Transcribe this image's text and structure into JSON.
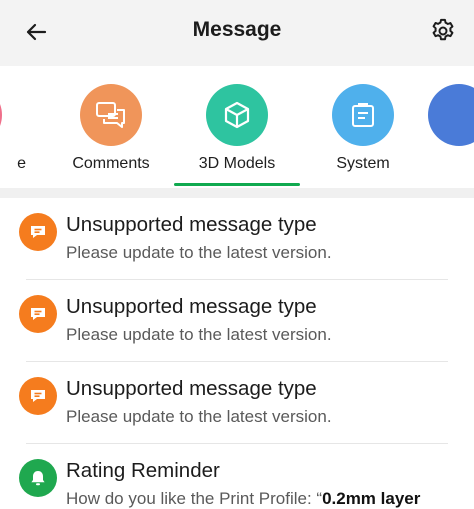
{
  "header": {
    "title": "Message",
    "back_icon": "arrow-left-icon",
    "settings_icon": "gear-icon"
  },
  "tabs": [
    {
      "label": "e",
      "icon": "partial-icon",
      "color": "#ef6f8a"
    },
    {
      "label": "Comments",
      "icon": "chat-bubbles-icon",
      "color": "#f0955a"
    },
    {
      "label": "3D Models",
      "icon": "cube-icon",
      "color": "#2ec4a0",
      "selected": true
    },
    {
      "label": "System",
      "icon": "clipboard-icon",
      "color": "#4fb0ec"
    },
    {
      "label": "",
      "icon": "partial-icon",
      "color": "#4a7bd8"
    }
  ],
  "accent_color": "#10a94f",
  "messages": [
    {
      "title": "Unsupported message type",
      "subtitle": "Please update to the latest version.",
      "icon": "message-icon",
      "color": "#f57c1e"
    },
    {
      "title": "Unsupported message type",
      "subtitle": "Please update to the latest version.",
      "icon": "message-icon",
      "color": "#f57c1e"
    },
    {
      "title": "Unsupported message type",
      "subtitle": "Please update to the latest version.",
      "icon": "message-icon",
      "color": "#f57c1e"
    },
    {
      "title": "Rating Reminder",
      "subtitle_prefix": "How do you like the Print Profile: “",
      "subtitle_bold": "0.2mm layer",
      "icon": "bell-icon",
      "color": "#1fa84f"
    }
  ]
}
